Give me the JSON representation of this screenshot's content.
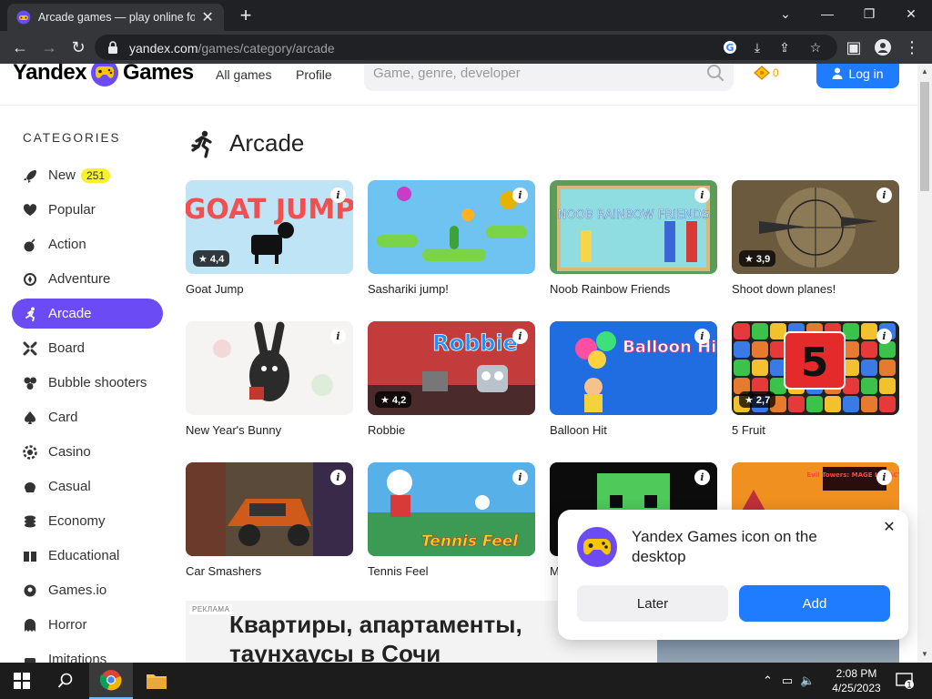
{
  "browser": {
    "tab_title": "Arcade games — play online for free",
    "new_tab": "+",
    "url_domain": "yandex.com",
    "url_path": "/games/category/arcade"
  },
  "header": {
    "logo_left": "Yandex",
    "logo_right": "Games",
    "nav": [
      "All games",
      "Profile"
    ],
    "search_placeholder": "Game, genre, developer",
    "coins": "0",
    "login": "Log in"
  },
  "sidebar": {
    "title": "CATEGORIES",
    "items": [
      {
        "label": "New",
        "badge": "251",
        "icon": "rocket-icon"
      },
      {
        "label": "Popular",
        "icon": "heart-icon"
      },
      {
        "label": "Action",
        "icon": "bomb-icon"
      },
      {
        "label": "Adventure",
        "icon": "compass-icon"
      },
      {
        "label": "Arcade",
        "icon": "running-man-icon",
        "active": true
      },
      {
        "label": "Board",
        "icon": "board-icon"
      },
      {
        "label": "Bubble shooters",
        "icon": "bubbles-icon"
      },
      {
        "label": "Card",
        "icon": "spade-icon"
      },
      {
        "label": "Casino",
        "icon": "chip-icon"
      },
      {
        "label": "Casual",
        "icon": "casual-icon"
      },
      {
        "label": "Economy",
        "icon": "coins-icon"
      },
      {
        "label": "Educational",
        "icon": "book-icon"
      },
      {
        "label": "Games.io",
        "icon": "io-icon"
      },
      {
        "label": "Horror",
        "icon": "ghost-icon"
      },
      {
        "label": "Imitations",
        "icon": "imitation-icon"
      }
    ]
  },
  "section": {
    "title": "Arcade"
  },
  "games": [
    {
      "name": "Goat Jump",
      "rating": "★ 4,4",
      "art": "GOAT JUMP"
    },
    {
      "name": "Sashariki jump!",
      "rating": ""
    },
    {
      "name": "Noob Rainbow Friends",
      "rating": "",
      "art": "NOOB RAINBOW FRIENDS"
    },
    {
      "name": "Shoot down planes!",
      "rating": "★ 3,9"
    },
    {
      "name": "New Year's Bunny",
      "rating": ""
    },
    {
      "name": "Robbie",
      "rating": "★ 4,2",
      "art": "Robbie"
    },
    {
      "name": "Balloon Hit",
      "rating": "",
      "art": "Balloon Hit"
    },
    {
      "name": "5 Fruit",
      "rating": "★ 2,7",
      "art": "5"
    },
    {
      "name": "Car Smashers",
      "rating": ""
    },
    {
      "name": "Tennis Feel",
      "rating": "",
      "art": "Tennis Feel"
    },
    {
      "name": "M",
      "rating": ""
    },
    {
      "name": "",
      "rating": "",
      "art": "Evil Towers: MAGE LEGACY"
    }
  ],
  "ad": {
    "tag": "РЕКЛАМА",
    "line1": "Квартиры, апартаменты,",
    "line2": "таунхаусы в Сочи"
  },
  "popup": {
    "text": "Yandex Games icon on the desktop",
    "later": "Later",
    "add": "Add"
  },
  "taskbar": {
    "time": "2:08 PM",
    "date": "4/25/2023",
    "notifications": "1"
  },
  "colors": {
    "accent": "#6b4bf4",
    "primary_button": "#1f7cff",
    "new_badge": "#f7f228",
    "chrome_dark": "#202124"
  }
}
